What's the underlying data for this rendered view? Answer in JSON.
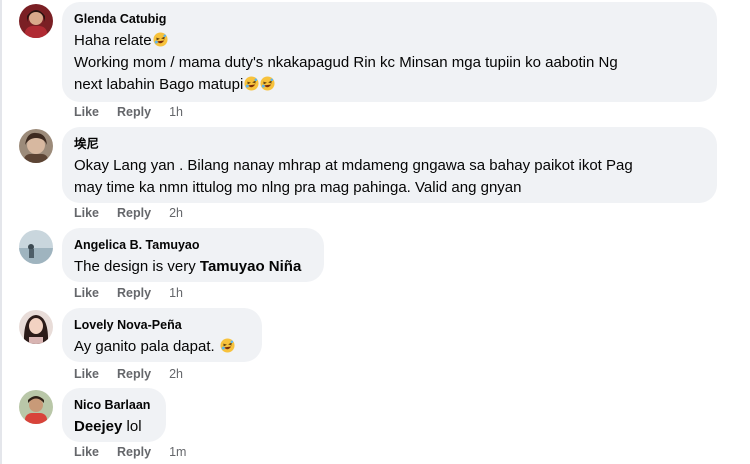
{
  "comments": [
    {
      "author": "Glenda Catubig",
      "line1": "Haha relate",
      "line2": "Working mom / mama duty's nkakapagud Rin kc Minsan mga tupiin ko aabotin Ng",
      "line3": "next labahin Bago matupi",
      "like": "Like",
      "reply": "Reply",
      "time": "1h",
      "emoji": "rofl-emoji"
    },
    {
      "author": "埃尼",
      "line1": "Okay Lang yan . Bilang nanay mhrap at mdameng gngawa sa bahay paikot ikot Pag",
      "line2": "may time ka nmn ittulog mo nlng pra mag pahinga. Valid ang gnyan",
      "like": "Like",
      "reply": "Reply",
      "time": "2h"
    },
    {
      "author": "Angelica B. Tamuyao",
      "text_prefix": "The design is very ",
      "mention": "Tamuyao Niña",
      "like": "Like",
      "reply": "Reply",
      "time": "1h"
    },
    {
      "author": "Lovely Nova-Peña",
      "line1": "Ay ganito pala dapat.",
      "like": "Like",
      "reply": "Reply",
      "time": "2h",
      "emoji": "rofl-emoji"
    },
    {
      "author": "Nico Barlaan",
      "mention": "Deejey",
      "text_suffix": " lol",
      "like": "Like",
      "reply": "Reply",
      "time": "1m"
    }
  ],
  "colors": {
    "bubble": "#f0f2f5",
    "meta": "#65676b",
    "text": "#050505"
  }
}
